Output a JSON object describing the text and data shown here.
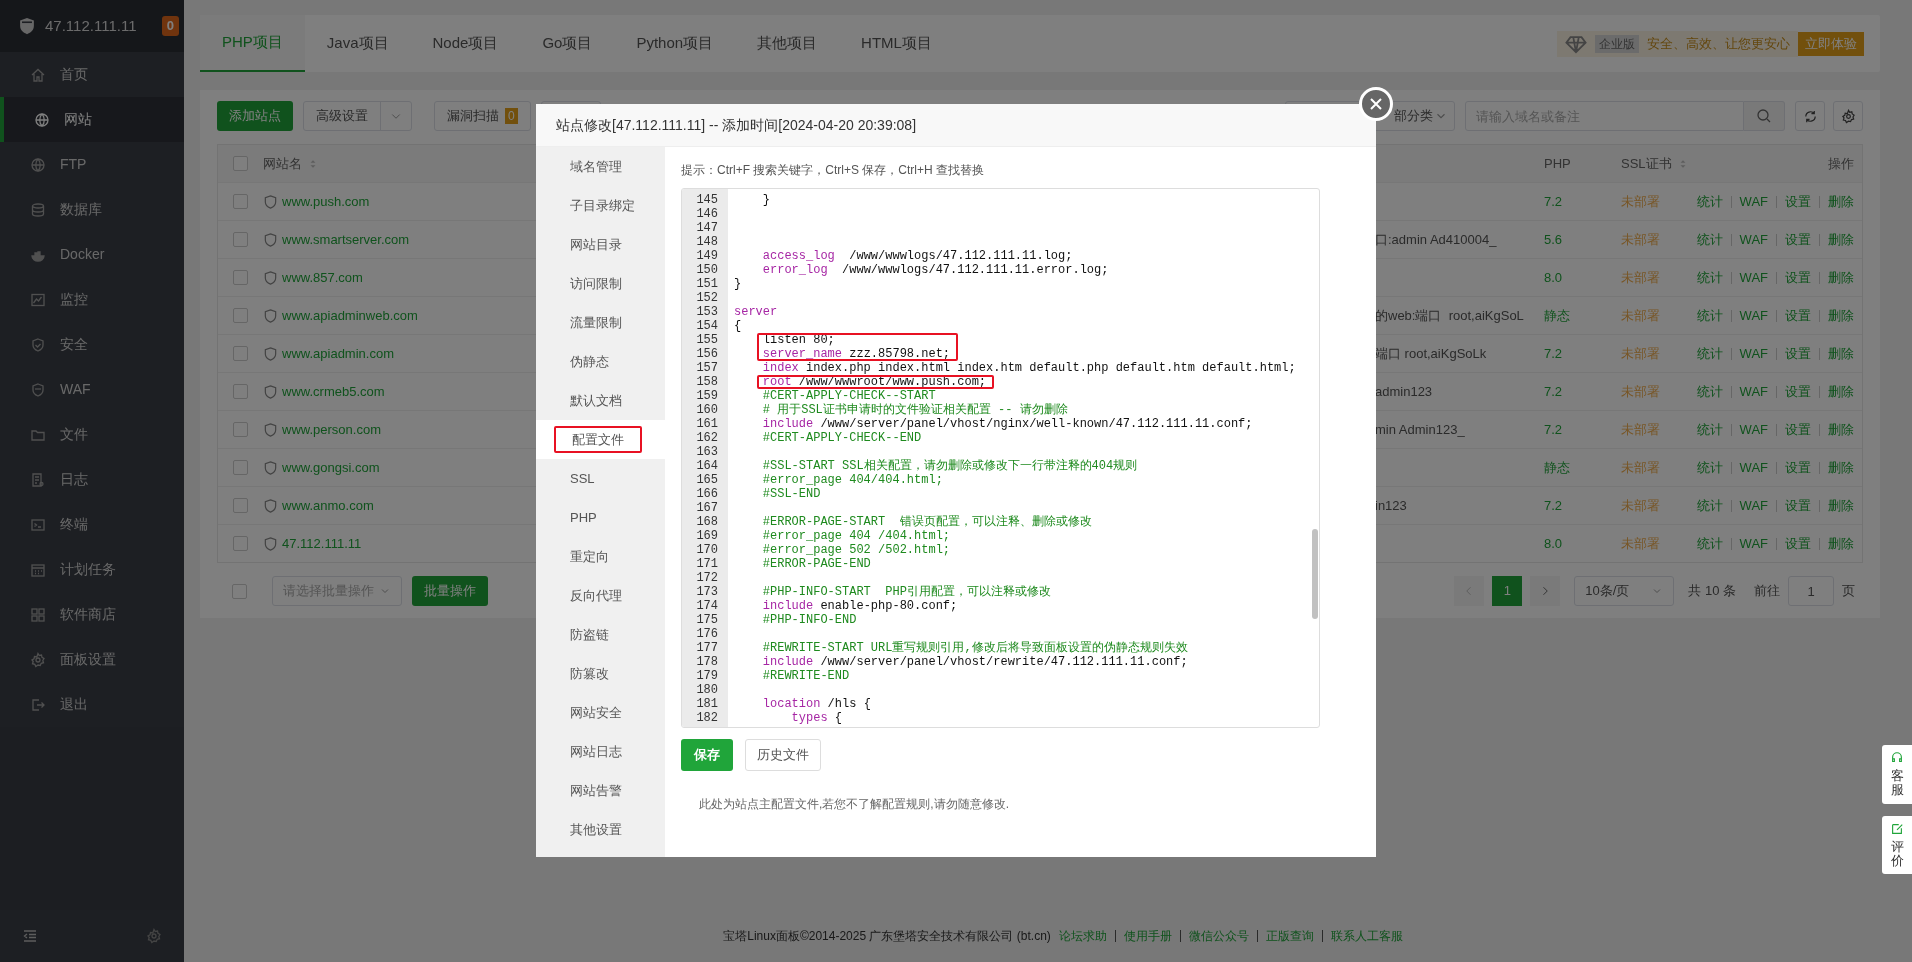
{
  "sidebar": {
    "host": "47.112.111.11",
    "badge": "0",
    "items": [
      {
        "label": "首页",
        "selected": false
      },
      {
        "label": "网站",
        "selected": true
      },
      {
        "label": "FTP",
        "selected": false
      },
      {
        "label": "数据库",
        "selected": false
      },
      {
        "label": "Docker",
        "selected": false
      },
      {
        "label": "监控",
        "selected": false
      },
      {
        "label": "安全",
        "selected": false
      },
      {
        "label": "WAF",
        "selected": false
      },
      {
        "label": "文件",
        "selected": false
      },
      {
        "label": "日志",
        "selected": false
      },
      {
        "label": "终端",
        "selected": false
      },
      {
        "label": "计划任务",
        "selected": false
      },
      {
        "label": "软件商店",
        "selected": false
      },
      {
        "label": "面板设置",
        "selected": false
      },
      {
        "label": "退出",
        "selected": false
      }
    ]
  },
  "tabs": [
    {
      "label": "PHP项目",
      "selected": true
    },
    {
      "label": "Java项目",
      "selected": false
    },
    {
      "label": "Node项目",
      "selected": false
    },
    {
      "label": "Go项目",
      "selected": false
    },
    {
      "label": "Python项目",
      "selected": false
    },
    {
      "label": "其他项目",
      "selected": false
    },
    {
      "label": "HTML项目",
      "selected": false
    }
  ],
  "promo": {
    "edition": "企业版",
    "slogan": "安全、高效、让您更安心",
    "button": "立即体验"
  },
  "toolbar": {
    "add_button": "添加站点",
    "advanced_button": "高级设置",
    "scan_button": "漏洞扫描",
    "scan_badge": "0",
    "category_select": "部分类",
    "search": {
      "placeholder": "请输入域名或备注"
    }
  },
  "table": {
    "select_all_checked": false,
    "columns": {
      "name": "网站名",
      "php": "PHP",
      "ssl": "SSL证书",
      "actions": "操作"
    },
    "rows": [
      {
        "name": "www.push.com",
        "checked": false,
        "php": "7.2",
        "ssl": "未部署",
        "actions": [
          "统计",
          "WAF",
          "设置",
          "删除"
        ]
      },
      {
        "name": "www.smartserver.com",
        "checked": false,
        "remark": "口:admin Ad410004_",
        "php": "5.6",
        "ssl": "未部署",
        "actions": [
          "统计",
          "WAF",
          "设置",
          "删除"
        ]
      },
      {
        "name": "www.857.com",
        "checked": false,
        "php": "8.0",
        "ssl": "未部署",
        "actions": [
          "统计",
          "WAF",
          "设置",
          "删除"
        ]
      },
      {
        "name": "www.apiadminweb.com",
        "checked": false,
        "remark": "的web:端口  root,aiKgSoL",
        "php": "静态",
        "ssl": "未部署",
        "actions": [
          "统计",
          "WAF",
          "设置",
          "删除"
        ]
      },
      {
        "name": "www.apiadmin.com",
        "checked": false,
        "remark": "端口 root,aiKgSoLk",
        "php": "7.2",
        "ssl": "未部署",
        "actions": [
          "统计",
          "WAF",
          "设置",
          "删除"
        ]
      },
      {
        "name": "www.crmeb5.com",
        "checked": false,
        "remark": "admin123",
        "php": "7.2",
        "ssl": "未部署",
        "actions": [
          "统计",
          "WAF",
          "设置",
          "删除"
        ]
      },
      {
        "name": "www.person.com",
        "checked": false,
        "remark": "min Admin123_",
        "php": "7.2",
        "ssl": "未部署",
        "actions": [
          "统计",
          "WAF",
          "设置",
          "删除"
        ]
      },
      {
        "name": "www.gongsi.com",
        "checked": false,
        "php": "静态",
        "ssl": "未部署",
        "actions": [
          "统计",
          "WAF",
          "设置",
          "删除"
        ]
      },
      {
        "name": "www.anmo.com",
        "checked": false,
        "remark": "in123",
        "php": "7.2",
        "ssl": "未部署",
        "actions": [
          "统计",
          "WAF",
          "设置",
          "删除"
        ]
      },
      {
        "name": "47.112.111.11",
        "checked": false,
        "php": "8.0",
        "ssl": "未部署",
        "actions": [
          "统计",
          "WAF",
          "设置",
          "删除"
        ]
      }
    ]
  },
  "bulk": {
    "checked": false,
    "select_placeholder": "请选择批量操作",
    "button": "批量操作"
  },
  "pagination": {
    "pages": [
      {
        "label": "1",
        "selected": true
      }
    ],
    "page_size": "10条/页",
    "total": "共 10 条",
    "goto_label": "前往",
    "goto_value": "1",
    "page_unit": "页"
  },
  "footer": {
    "copyright": "宝塔Linux面板©2014-2025 广东堡塔安全技术有限公司 (bt.cn)",
    "links": [
      "论坛求助",
      "使用手册",
      "微信公众号",
      "正版查询",
      "联系人工客服"
    ]
  },
  "float_tabs": [
    {
      "label": "客服"
    },
    {
      "label": "评价"
    }
  ],
  "modal": {
    "title": "站点修改[47.112.111.11] -- 添加时间[2024-04-20 20:39:08]",
    "nav": [
      {
        "label": "域名管理",
        "selected": false,
        "boxed": false
      },
      {
        "label": "子目录绑定",
        "selected": false,
        "boxed": false
      },
      {
        "label": "网站目录",
        "selected": false,
        "boxed": false
      },
      {
        "label": "访问限制",
        "selected": false,
        "boxed": false
      },
      {
        "label": "流量限制",
        "selected": false,
        "boxed": false
      },
      {
        "label": "伪静态",
        "selected": false,
        "boxed": false
      },
      {
        "label": "默认文档",
        "selected": false,
        "boxed": false
      },
      {
        "label": "配置文件",
        "selected": true,
        "boxed": true
      },
      {
        "label": "SSL",
        "selected": false,
        "boxed": false
      },
      {
        "label": "PHP",
        "selected": false,
        "boxed": false
      },
      {
        "label": "重定向",
        "selected": false,
        "boxed": false
      },
      {
        "label": "反向代理",
        "selected": false,
        "boxed": false
      },
      {
        "label": "防盗链",
        "selected": false,
        "boxed": false
      },
      {
        "label": "防篡改",
        "selected": false,
        "boxed": false
      },
      {
        "label": "网站安全",
        "selected": false,
        "boxed": false
      },
      {
        "label": "网站日志",
        "selected": false,
        "boxed": false
      },
      {
        "label": "网站告警",
        "selected": false,
        "boxed": false
      },
      {
        "label": "其他设置",
        "selected": false,
        "boxed": false
      }
    ],
    "hint": "提示：Ctrl+F 搜索关键字，Ctrl+S 保存，Ctrl+H 查找替换",
    "editor": {
      "lines": [
        {
          "num": "145",
          "boxed": false,
          "parts": [
            {
              "kind": "plain",
              "text": "    }"
            }
          ]
        },
        {
          "num": "146",
          "boxed": false
        },
        {
          "num": "147",
          "boxed": false
        },
        {
          "num": "148",
          "boxed": false
        },
        {
          "num": "149",
          "boxed": false,
          "parts": [
            {
              "kind": "keyword",
              "text": "    access_log"
            },
            {
              "kind": "plain",
              "text": "  /www/wwwlogs/47.112.111.11.log;"
            }
          ]
        },
        {
          "num": "150",
          "boxed": false,
          "parts": [
            {
              "kind": "keyword",
              "text": "    error_log"
            },
            {
              "kind": "plain",
              "text": "  /www/wwwlogs/47.112.111.11.error.log;"
            }
          ]
        },
        {
          "num": "151",
          "boxed": false,
          "parts": [
            {
              "kind": "plain",
              "text": "}"
            }
          ]
        },
        {
          "num": "152",
          "boxed": false
        },
        {
          "num": "153",
          "boxed": false,
          "parts": [
            {
              "kind": "keyword",
              "text": "server"
            }
          ]
        },
        {
          "num": "154",
          "boxed": false,
          "parts": [
            {
              "kind": "plain",
              "text": "{"
            }
          ]
        },
        {
          "num": "155",
          "boxed": true,
          "parts": [
            {
              "kind": "plain",
              "text": "    listen 80;"
            }
          ]
        },
        {
          "num": "156",
          "boxed": true,
          "parts": [
            {
              "kind": "keyword",
              "text": "    server_name"
            },
            {
              "kind": "plain",
              "text": " zzz.85798.net;"
            }
          ]
        },
        {
          "num": "157",
          "boxed": false,
          "parts": [
            {
              "kind": "keyword",
              "text": "    index"
            },
            {
              "kind": "plain",
              "text": " index.php index.html index.htm default.php default.htm default.html;"
            }
          ]
        },
        {
          "num": "158",
          "boxed": true,
          "parts": [
            {
              "kind": "keyword",
              "text": "    root"
            },
            {
              "kind": "plain",
              "text": " /www/wwwroot/www.push.com;"
            }
          ]
        },
        {
          "num": "159",
          "boxed": false,
          "parts": [
            {
              "kind": "comment",
              "text": "    #CERT-APPLY-CHECK--START"
            }
          ]
        },
        {
          "num": "160",
          "boxed": false,
          "parts": [
            {
              "kind": "comment",
              "text": "    # 用于SSL证书申请时的文件验证相关配置 -- 请勿删除"
            }
          ]
        },
        {
          "num": "161",
          "boxed": false,
          "parts": [
            {
              "kind": "keyword",
              "text": "    include"
            },
            {
              "kind": "plain",
              "text": " /www/server/panel/vhost/nginx/well-known/47.112.111.11.conf;"
            }
          ]
        },
        {
          "num": "162",
          "boxed": false,
          "parts": [
            {
              "kind": "comment",
              "text": "    #CERT-APPLY-CHECK--END"
            }
          ]
        },
        {
          "num": "163",
          "boxed": false
        },
        {
          "num": "164",
          "boxed": false,
          "parts": [
            {
              "kind": "comment",
              "text": "    #SSL-START SSL相关配置，请勿删除或修改下一行带注释的404规则"
            }
          ]
        },
        {
          "num": "165",
          "boxed": false,
          "parts": [
            {
              "kind": "comment",
              "text": "    #error_page 404/404.html;"
            }
          ]
        },
        {
          "num": "166",
          "boxed": false,
          "parts": [
            {
              "kind": "comment",
              "text": "    #SSL-END"
            }
          ]
        },
        {
          "num": "167",
          "boxed": false
        },
        {
          "num": "168",
          "boxed": false,
          "parts": [
            {
              "kind": "comment",
              "text": "    #ERROR-PAGE-START  错误页配置，可以注释、删除或修改"
            }
          ]
        },
        {
          "num": "169",
          "boxed": false,
          "parts": [
            {
              "kind": "comment",
              "text": "    #error_page 404 /404.html;"
            }
          ]
        },
        {
          "num": "170",
          "boxed": false,
          "parts": [
            {
              "kind": "comment",
              "text": "    #error_page 502 /502.html;"
            }
          ]
        },
        {
          "num": "171",
          "boxed": false,
          "parts": [
            {
              "kind": "comment",
              "text": "    #ERROR-PAGE-END"
            }
          ]
        },
        {
          "num": "172",
          "boxed": false
        },
        {
          "num": "173",
          "boxed": false,
          "parts": [
            {
              "kind": "comment",
              "text": "    #PHP-INFO-START  PHP引用配置，可以注释或修改"
            }
          ]
        },
        {
          "num": "174",
          "boxed": false,
          "parts": [
            {
              "kind": "keyword",
              "text": "    include"
            },
            {
              "kind": "plain",
              "text": " enable-php-80.conf;"
            }
          ]
        },
        {
          "num": "175",
          "boxed": false,
          "parts": [
            {
              "kind": "comment",
              "text": "    #PHP-INFO-END"
            }
          ]
        },
        {
          "num": "176",
          "boxed": false
        },
        {
          "num": "177",
          "boxed": false,
          "parts": [
            {
              "kind": "comment",
              "text": "    #REWRITE-START URL重写规则引用,修改后将导致面板设置的伪静态规则失效"
            }
          ]
        },
        {
          "num": "178",
          "boxed": false,
          "parts": [
            {
              "kind": "keyword",
              "text": "    include"
            },
            {
              "kind": "plain",
              "text": " /www/server/panel/vhost/rewrite/47.112.111.11.conf;"
            }
          ]
        },
        {
          "num": "179",
          "boxed": false,
          "parts": [
            {
              "kind": "comment",
              "text": "    #REWRITE-END"
            }
          ]
        },
        {
          "num": "180",
          "boxed": false
        },
        {
          "num": "181",
          "boxed": false,
          "parts": [
            {
              "kind": "keyword",
              "text": "    location"
            },
            {
              "kind": "plain",
              "text": " /hls {"
            }
          ]
        },
        {
          "num": "182",
          "boxed": false,
          "parts": [
            {
              "kind": "keyword",
              "text": "        types"
            },
            {
              "kind": "plain",
              "text": " {"
            }
          ]
        }
      ]
    },
    "save_button": "保存",
    "history_button": "历史文件",
    "note": "此处为站点主配置文件,若您不了解配置规则,请勿随意修改."
  }
}
